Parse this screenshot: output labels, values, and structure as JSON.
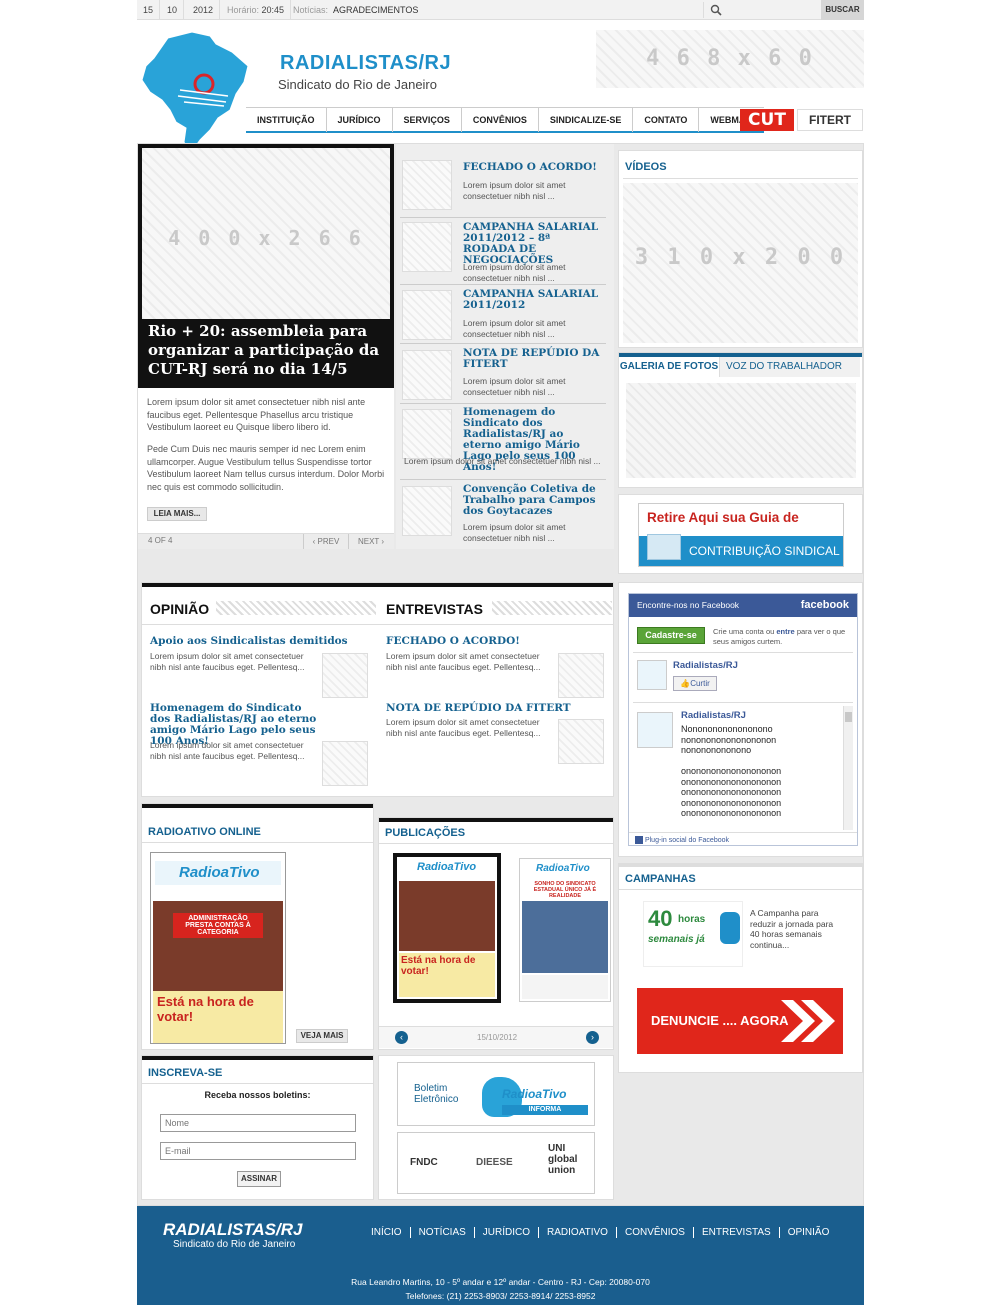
{
  "topbar": {
    "day": "15",
    "month": "10",
    "year": "2012",
    "time_label": "Horário:",
    "time": "20:45",
    "news_label": "Notícias:",
    "news": "AGRADECIMENTOS",
    "search_button": "BUSCAR"
  },
  "header": {
    "title": "RADIALISTAS/RJ",
    "subtitle": "Sindicato do Rio de Janeiro",
    "banner": "4 6 8 x 6 0",
    "partners": [
      "CUT",
      "FITERT"
    ]
  },
  "nav": [
    "INSTITUIÇÃO",
    "JURÍDICO",
    "SERVIÇOS",
    "CONVÊNIOS",
    "SINDICALIZE-SE",
    "CONTATO",
    "WEBMAIL"
  ],
  "featured": {
    "image": "4 0 0 x 2 6 6",
    "title": "Rio + 20: assembleia para organizar a participação da CUT-RJ será no dia 14/5",
    "para1": "Lorem ipsum dolor sit amet consectetuer nibh nisl ante faucibus eget. Pellentesque Phasellus arcu tristique Vestibulum laoreet eu Quisque libero libero id.",
    "para2": "Pede Cum Duis nec mauris semper id nec Lorem enim ullamcorper. Augue Vestibulum tellus Suspendisse tortor Vestibulum laoreet Nam tellus cursus interdum. Dolor Morbi nec quis est commodo sollicitudin.",
    "more": "LEIA MAIS...",
    "counter": "4 OF 4",
    "prev": "‹ PREV",
    "next": "NEXT ›"
  },
  "news_list": [
    {
      "title": "FECHADO O ACORDO!",
      "text": "Lorem ipsum dolor sit amet consectetuer nibh nisl ..."
    },
    {
      "title": "CAMPANHA SALARIAL 2011/2012 – 8ª RODADA DE NEGOCIAÇÕES",
      "text": "Lorem ipsum dolor sit amet consectetuer nibh nisl ..."
    },
    {
      "title": "CAMPANHA SALARIAL 2011/2012",
      "text": "Lorem ipsum dolor sit amet consectetuer nibh nisl ..."
    },
    {
      "title": "NOTA DE REPÚDIO DA FITERT",
      "text": "Lorem ipsum dolor sit amet consectetuer nibh nisl ..."
    },
    {
      "title": "Homenagem do Sindicato dos Radialistas/RJ ao eterno amigo Mário Lago pelo seus 100 Anos!",
      "text": "Lorem ipsum dolor sit amet consectetuer nibh nisl ..."
    },
    {
      "title": "Convenção Coletiva de Trabalho para Campos dos Goytacazes",
      "text": "Lorem ipsum dolor sit amet consectetuer nibh nisl ..."
    }
  ],
  "videos": {
    "title": "VÍDEOS",
    "image": "3 1 0 x 2 0 0"
  },
  "gallery": {
    "tab1": "GALERIA DE FOTOS",
    "tab2": "VOZ DO TRABALHADOR"
  },
  "guide": {
    "line1": "Retire Aqui sua Guia de",
    "line2": "CONTRIBUIÇÃO SINDICAL"
  },
  "opiniao": {
    "title": "OPINIÃO",
    "items": [
      {
        "title": "Apoio aos Sindicalistas demitidos",
        "text": "Lorem ipsum dolor sit amet consectetuer nibh nisl ante faucibus eget. Pellentesq..."
      },
      {
        "title": "Homenagem do Sindicato dos Radialistas/RJ ao eterno amigo Mário Lago pelo seus 100 Anos!",
        "text": "Lorem ipsum dolor sit amet consectetuer nibh nisl ante faucibus eget. Pellentesq..."
      }
    ]
  },
  "entrevistas": {
    "title": "ENTREVISTAS",
    "items": [
      {
        "title": "FECHADO O ACORDO!",
        "text": "Lorem ipsum dolor sit amet consectetuer nibh nisl ante faucibus eget. Pellentesq..."
      },
      {
        "title": "NOTA DE REPÚDIO DA FITERT",
        "text": "Lorem ipsum dolor sit amet consectetuer nibh nisl ante faucibus eget. Pellentesq..."
      }
    ]
  },
  "facebook": {
    "header": "Encontre-nos no Facebook",
    "brand": "facebook",
    "signup": "Cadastre-se",
    "signup_text_a": "Crie uma conta ou",
    "signup_text_b": "entre",
    "signup_text_c": "para ver o que seus amigos curtem.",
    "page": "Radialistas/RJ",
    "like": "Curtir",
    "post_author": "Radialistas/RJ",
    "post_lines": [
      "Nonononononononono",
      "nononononononononon",
      "nonononononono",
      "",
      "onononononononononon",
      "onononononononononon",
      "onononononononononon",
      "onononononononononon",
      "onononononononononon"
    ],
    "plugin": "Plug-in social do Facebook"
  },
  "radioativo": {
    "title": "RADIOATIVO ONLINE",
    "cover_title": "RadioaTivo",
    "headline1": "ADMINISTRAÇÃO PRESTA CONTAS À CATEGORIA",
    "headline2": "Está na hora de votar!",
    "more": "VEJA MAIS"
  },
  "publicacoes": {
    "title": "PUBLICAÇÕES",
    "cover_title": "RadioaTivo",
    "headline": "Está na hora de votar!",
    "headline2": "SONHO DO SINDICATO ESTADUAL ÚNICO JÁ É REALIDADE",
    "date": "15/10/2012"
  },
  "campanhas": {
    "title": "CAMPANHAS",
    "badge_a": "40",
    "badge_b": "horas",
    "badge_c": "semanais já",
    "text": "A Campanha para reduzir a jornada para 40 horas semanais continua...",
    "denuncie": "DENUNCIE .... AGORA"
  },
  "inscreva": {
    "title": "INSCREVA-SE",
    "prompt": "Receba nossos boletins:",
    "name": "Nome",
    "email": "E-mail",
    "submit": "ASSINAR"
  },
  "boletim": {
    "line1": "Boletim",
    "line2": "Eletrônico",
    "brand": "RadioaTivo",
    "brand2": "INFORMA"
  },
  "logos": [
    "FNDC",
    "DIEESE",
    "UNI global union"
  ],
  "footer": {
    "title": "RADIALISTAS/RJ",
    "subtitle": "Sindicato do Rio de Janeiro",
    "nav": [
      "INÍCIO",
      "NOTÍCIAS",
      "JURÍDICO",
      "RADIOATIVO",
      "CONVÊNIOS",
      "ENTREVISTAS",
      "OPINIÃO"
    ],
    "address": "Rua Leandro Martins, 10 - 5º andar e 12º andar - Centro - RJ - Cep: 20080-070",
    "phones": "Telefones: (21) 2253-8903/ 2253-8914/ 2253-8952"
  },
  "colors": {
    "accent": "#15618f",
    "brand_blue": "#1f8fc9",
    "footer": "#1a5e8e",
    "red": "#e0261b"
  }
}
